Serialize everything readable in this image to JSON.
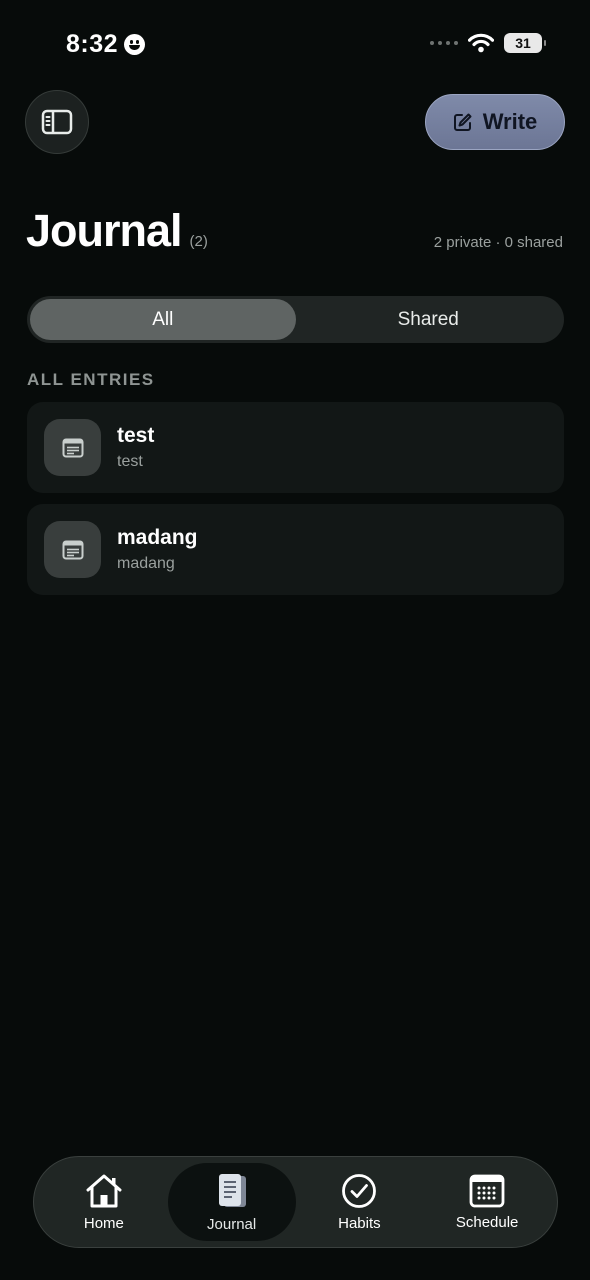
{
  "status_bar": {
    "time": "8:32",
    "battery": "31"
  },
  "header": {
    "sidebar_icon": "sidebar-panel-icon",
    "write_label": "Write",
    "write_icon": "edit-square-icon"
  },
  "page": {
    "title": "Journal",
    "count": "(2)",
    "summary": "2 private · 0 shared"
  },
  "segments": [
    {
      "label": "All",
      "active": true
    },
    {
      "label": "Shared",
      "active": false
    }
  ],
  "section_header": "ALL ENTRIES",
  "entries": [
    {
      "title": "test",
      "preview": "test",
      "icon": "document-icon"
    },
    {
      "title": "madang",
      "preview": "madang",
      "icon": "document-icon"
    }
  ],
  "tabbar": {
    "tabs": [
      {
        "label": "Home",
        "icon": "home-icon",
        "active": false
      },
      {
        "label": "Journal",
        "icon": "journal-icon",
        "active": true
      },
      {
        "label": "Habits",
        "icon": "check-circle-icon",
        "active": false
      },
      {
        "label": "Schedule",
        "icon": "calendar-icon",
        "active": false
      }
    ]
  },
  "colors": {
    "background": "#070b0a",
    "write_button": "#7f8aa9",
    "card": "#121716",
    "segment_active": "#5f6463"
  }
}
